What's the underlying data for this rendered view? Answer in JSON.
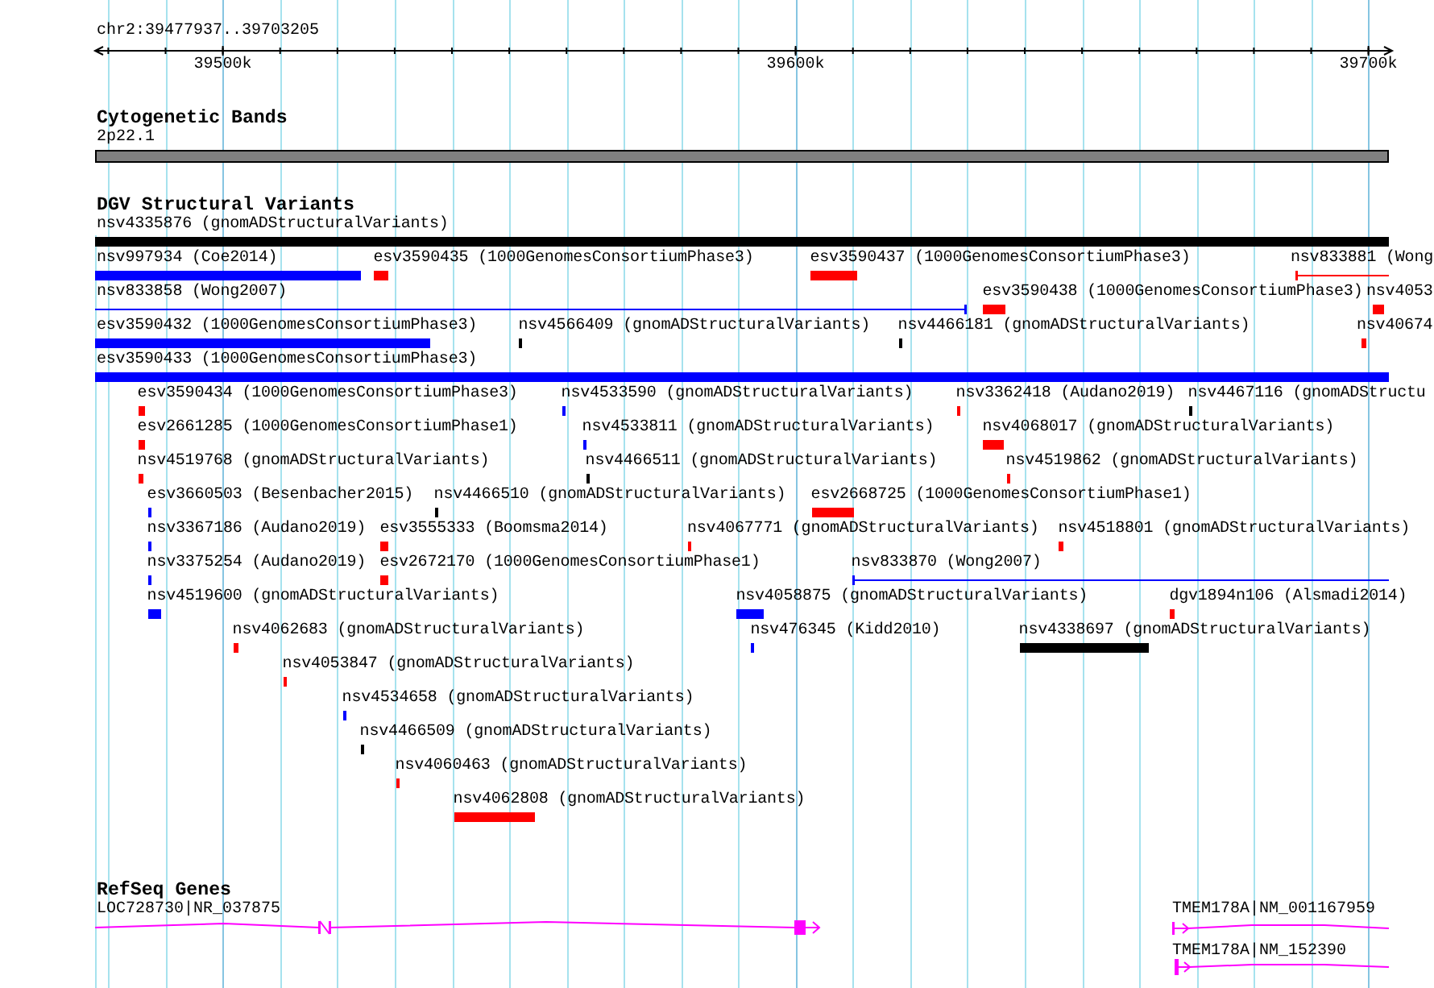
{
  "ruler": {
    "region": "chr2:39477937..39703205",
    "ticks": [
      "39500k",
      "39600k",
      "39700k"
    ]
  },
  "cytogenetic_bands": {
    "title": "Cytogenetic Bands",
    "bands": [
      {
        "label": "2p22.1"
      }
    ]
  },
  "structural_variants": {
    "title": "DGV Structural Variants",
    "features": [
      {
        "label": "nsv4335876 (gnomADStructuralVariants)",
        "color": "#000000",
        "kind": "bar"
      },
      {
        "label": "nsv997934 (Coe2014)",
        "color": "#0000ff",
        "kind": "bar"
      },
      {
        "label": "esv3590435 (1000GenomesConsortiumPhase3)",
        "color": "#ff0000",
        "kind": "bar"
      },
      {
        "label": "esv3590437 (1000GenomesConsortiumPhase3)",
        "color": "#ff0000",
        "kind": "bar"
      },
      {
        "label": "nsv833881 (Wong",
        "color": "#ff0000",
        "kind": "line"
      },
      {
        "label": "nsv833858 (Wong2007)",
        "color": "#0000ff",
        "kind": "line"
      },
      {
        "label": "esv3590438 (1000GenomesConsortiumPhase3)",
        "color": "#ff0000",
        "kind": "bar"
      },
      {
        "label": "nsv4053",
        "color": "#ff0000",
        "kind": "bar"
      },
      {
        "label": "esv3590432 (1000GenomesConsortiumPhase3)",
        "color": "#0000ff",
        "kind": "bar"
      },
      {
        "label": "nsv4566409 (gnomADStructuralVariants)",
        "color": "#000000",
        "kind": "bar"
      },
      {
        "label": "nsv4466181 (gnomADStructuralVariants)",
        "color": "#000000",
        "kind": "bar"
      },
      {
        "label": "nsv40674",
        "color": "#ff0000",
        "kind": "bar"
      },
      {
        "label": "esv3590433 (1000GenomesConsortiumPhase3)",
        "color": "#0000ff",
        "kind": "bar"
      },
      {
        "label": "esv3590434 (1000GenomesConsortiumPhase3)",
        "color": "#ff0000",
        "kind": "bar"
      },
      {
        "label": "nsv4533590 (gnomADStructuralVariants)",
        "color": "#0000ff",
        "kind": "bar"
      },
      {
        "label": "nsv3362418 (Audano2019)",
        "color": "#ff0000",
        "kind": "bar"
      },
      {
        "label": "nsv4467116 (gnomADStructu",
        "color": "#000000",
        "kind": "bar"
      },
      {
        "label": "esv2661285 (1000GenomesConsortiumPhase1)",
        "color": "#ff0000",
        "kind": "bar"
      },
      {
        "label": "nsv4533811 (gnomADStructuralVariants)",
        "color": "#0000ff",
        "kind": "bar"
      },
      {
        "label": "nsv4068017 (gnomADStructuralVariants)",
        "color": "#ff0000",
        "kind": "bar"
      },
      {
        "label": "nsv4519768 (gnomADStructuralVariants)",
        "color": "#ff0000",
        "kind": "bar"
      },
      {
        "label": "nsv4466511 (gnomADStructuralVariants)",
        "color": "#000000",
        "kind": "bar"
      },
      {
        "label": "nsv4519862 (gnomADStructuralVariants)",
        "color": "#ff0000",
        "kind": "bar"
      },
      {
        "label": "esv3660503 (Besenbacher2015)",
        "color": "#0000ff",
        "kind": "bar"
      },
      {
        "label": "nsv4466510 (gnomADStructuralVariants)",
        "color": "#000000",
        "kind": "bar"
      },
      {
        "label": "esv2668725 (1000GenomesConsortiumPhase1)",
        "color": "#ff0000",
        "kind": "bar"
      },
      {
        "label": "nsv3367186 (Audano2019)",
        "color": "#0000ff",
        "kind": "bar"
      },
      {
        "label": "esv3555333 (Boomsma2014)",
        "color": "#ff0000",
        "kind": "bar"
      },
      {
        "label": "nsv4067771 (gnomADStructuralVariants)",
        "color": "#ff0000",
        "kind": "bar"
      },
      {
        "label": "nsv4518801 (gnomADStructuralVariants)",
        "color": "#ff0000",
        "kind": "bar"
      },
      {
        "label": "nsv3375254 (Audano2019)",
        "color": "#0000ff",
        "kind": "bar"
      },
      {
        "label": "esv2672170 (1000GenomesConsortiumPhase1)",
        "color": "#ff0000",
        "kind": "bar"
      },
      {
        "label": "nsv833870 (Wong2007)",
        "color": "#0000ff",
        "kind": "line"
      },
      {
        "label": "nsv4519600 (gnomADStructuralVariants)",
        "color": "#0000ff",
        "kind": "bar"
      },
      {
        "label": "nsv4058875 (gnomADStructuralVariants)",
        "color": "#0000ff",
        "kind": "bar"
      },
      {
        "label": "dgv1894n106 (Alsmadi2014)",
        "color": "#ff0000",
        "kind": "bar"
      },
      {
        "label": "nsv4062683 (gnomADStructuralVariants)",
        "color": "#ff0000",
        "kind": "bar"
      },
      {
        "label": "nsv476345 (Kidd2010)",
        "color": "#0000ff",
        "kind": "bar"
      },
      {
        "label": "nsv4338697 (gnomADStructuralVariants)",
        "color": "#000000",
        "kind": "bar"
      },
      {
        "label": "nsv4053847 (gnomADStructuralVariants)",
        "color": "#ff0000",
        "kind": "bar"
      },
      {
        "label": "nsv4534658 (gnomADStructuralVariants)",
        "color": "#0000ff",
        "kind": "bar"
      },
      {
        "label": "nsv4466509 (gnomADStructuralVariants)",
        "color": "#000000",
        "kind": "bar"
      },
      {
        "label": "nsv4060463 (gnomADStructuralVariants)",
        "color": "#ff0000",
        "kind": "bar"
      },
      {
        "label": "nsv4062808 (gnomADStructuralVariants)",
        "color": "#ff0000",
        "kind": "bar"
      }
    ]
  },
  "refseq_genes": {
    "title": "RefSeq Genes",
    "genes": [
      {
        "label": "LOC728730|NR_037875"
      },
      {
        "label": "TMEM178A|NM_001167959"
      },
      {
        "label": "TMEM178A|NM_152390"
      }
    ]
  }
}
